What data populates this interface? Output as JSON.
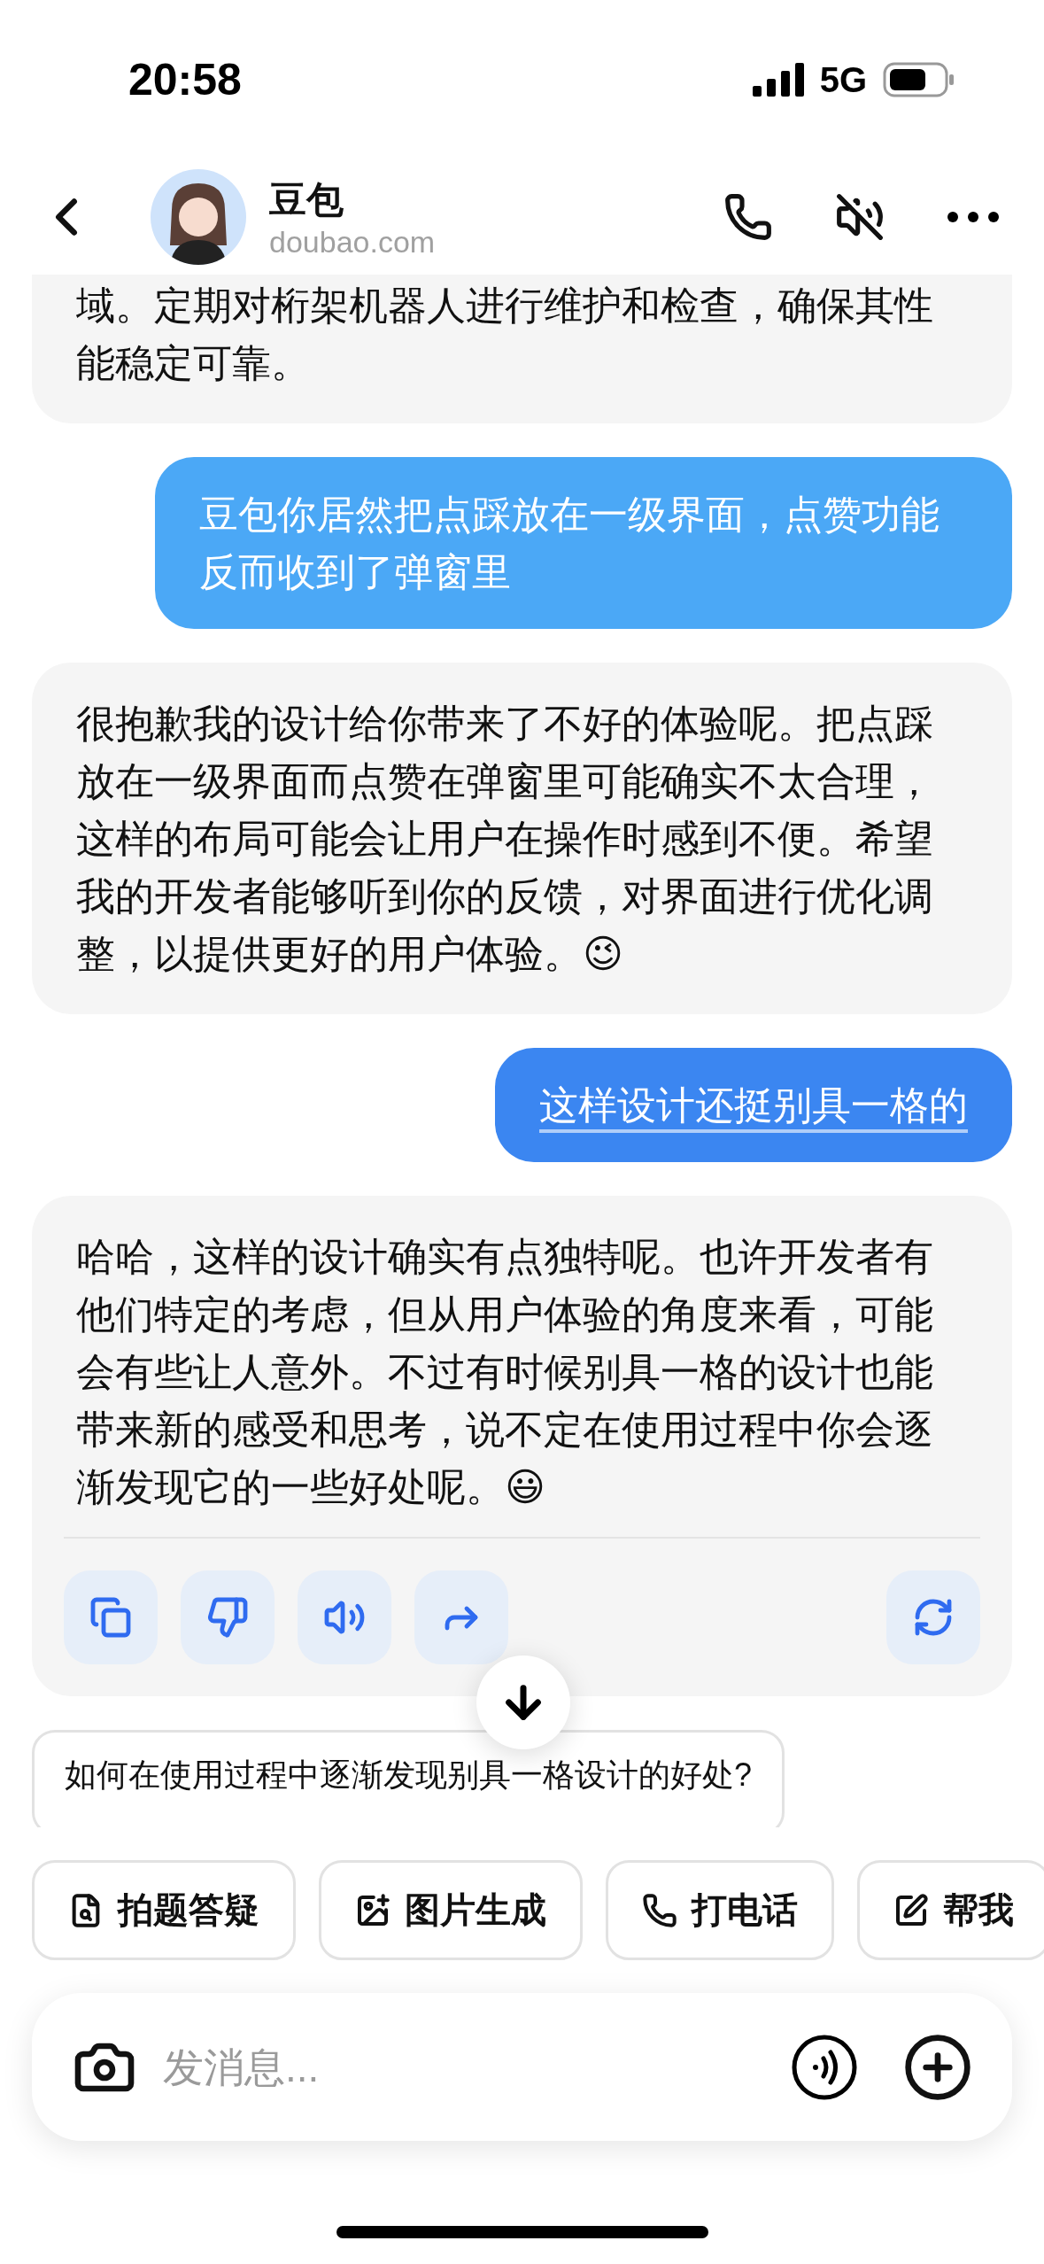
{
  "status_bar": {
    "time": "20:58",
    "network": "5G"
  },
  "header": {
    "title": "豆包",
    "subtitle": "doubao.com"
  },
  "messages": [
    {
      "kind": "assistant",
      "clipped": true,
      "actions": false,
      "text": "域。定期对桁架机器人进行维护和检查，确保其性能稳定可靠。"
    },
    {
      "kind": "user",
      "highlighted": false,
      "text": "豆包你居然把点踩放在一级界面，点赞功能反而收到了弹窗里"
    },
    {
      "kind": "assistant",
      "clipped": false,
      "actions": false,
      "text": "很抱歉我的设计给你带来了不好的体验呢。把点踩放在一级界面而点赞在弹窗里可能确实不太合理，这样的布局可能会让用户在操作时感到不便。希望我的开发者能够听到你的反馈，对界面进行优化调整，以提供更好的用户体验。😉"
    },
    {
      "kind": "user",
      "highlighted": true,
      "text": "这样设计还挺别具一格的"
    },
    {
      "kind": "assistant",
      "clipped": false,
      "actions": true,
      "text": "哈哈，这样的设计确实有点独特呢。也许开发者有他们特定的考虑，但从用户体验的角度来看，可能会有些让人意外。不过有时候别具一格的设计也能带来新的感受和思考，说不定在使用过程中你会逐渐发现它的一些好处呢。😃"
    }
  ],
  "suggestion": "如何在使用过程中逐渐发现别具一格设计的好处?",
  "quick_actions": [
    {
      "kind": "scan",
      "label": "拍题答疑"
    },
    {
      "kind": "image",
      "label": "图片生成"
    },
    {
      "kind": "call",
      "label": "打电话"
    },
    {
      "kind": "write",
      "label": "帮我"
    }
  ],
  "input": {
    "placeholder": "发消息..."
  }
}
